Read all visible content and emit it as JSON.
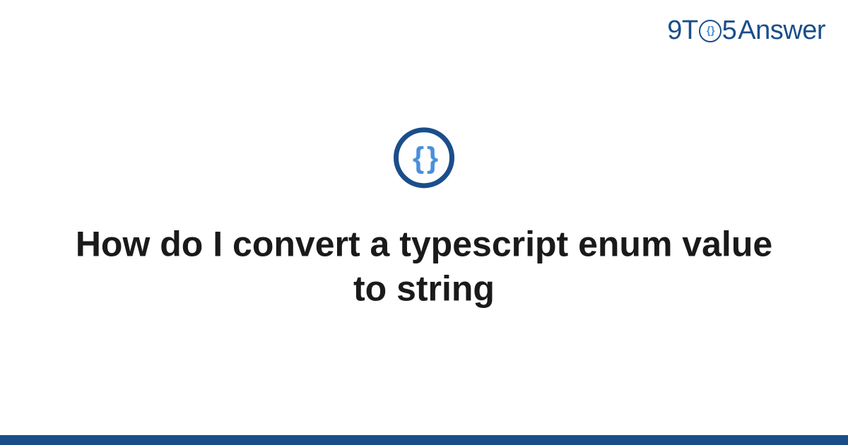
{
  "logo": {
    "prefix": "9T",
    "icon_content": "{ }",
    "middle": "5",
    "suffix": "Answer"
  },
  "main": {
    "icon_content": "{ }",
    "title": "How do I convert a typescript enum value to string"
  }
}
